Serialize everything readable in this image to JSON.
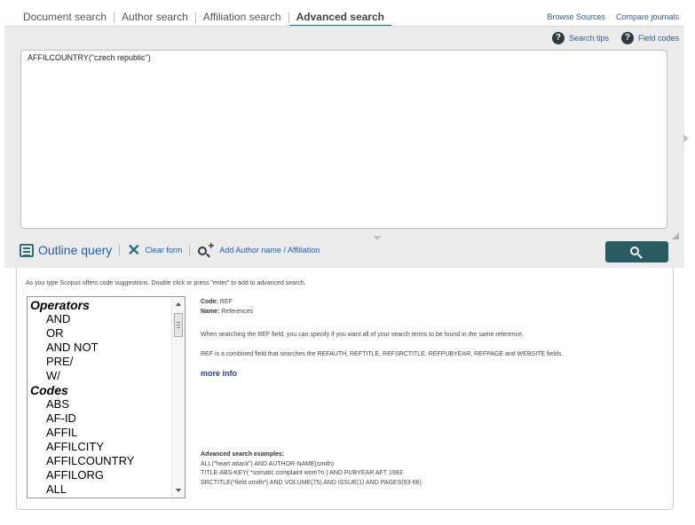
{
  "tabs": [
    {
      "label": "Document search"
    },
    {
      "label": "Author search"
    },
    {
      "label": "Affiliation search"
    },
    {
      "label": "Advanced search"
    }
  ],
  "top_links": {
    "browse": "Browse Sources",
    "compare": "Compare journals"
  },
  "help": {
    "search_tips": "Search tips",
    "field_codes": "Field codes"
  },
  "query": {
    "value": "AFFILCOUNTRY(\"czech republic\")"
  },
  "toolbar": {
    "outline": "Outline query",
    "clear": "Clear form",
    "add_author": "Add Author name / Affiliation"
  },
  "hint": "As you type Scopus offers code suggestions. Double click or press \"enter\" to add to advanced search.",
  "code_list": {
    "operators_heading": "Operators",
    "operators": [
      "AND",
      "OR",
      "AND NOT",
      "PRE/",
      "W/"
    ],
    "codes_heading": "Codes",
    "codes": [
      "ABS",
      "AF-ID",
      "AFFIL",
      "AFFILCITY",
      "AFFILCOUNTRY",
      "AFFILORG",
      "ALL"
    ]
  },
  "details": {
    "code_label": "Code:",
    "code_value": "REF",
    "name_label": "Name:",
    "name_value": "References",
    "para1": "When searching the REF field, you can specify if you want all of your search terms to be found in the same reference.",
    "para2": "REF is a combined field that searches the REFAUTH, REFTITLE, REFSRCTITLE, REFPUBYEAR, REFPAGE and WEBSITE fields.",
    "more_info": "more info"
  },
  "examples": {
    "title": "Advanced search examples:",
    "lines": [
      "ALL(\"heart attack\") AND AUTHOR-NAME(smith)",
      "TITLE-ABS-KEY( *somatic complaint wom?n ) AND PUBYEAR AFT 1993",
      "SRCTITLE(*field ornith*) AND VOLUME(75) AND ISSUE(1) AND PAGES(53-66)"
    ]
  },
  "colors": {
    "accent": "#2e6e76",
    "link": "#1f5ea8",
    "panel_bg": "#ebebeb",
    "button": "#2a5b63"
  }
}
